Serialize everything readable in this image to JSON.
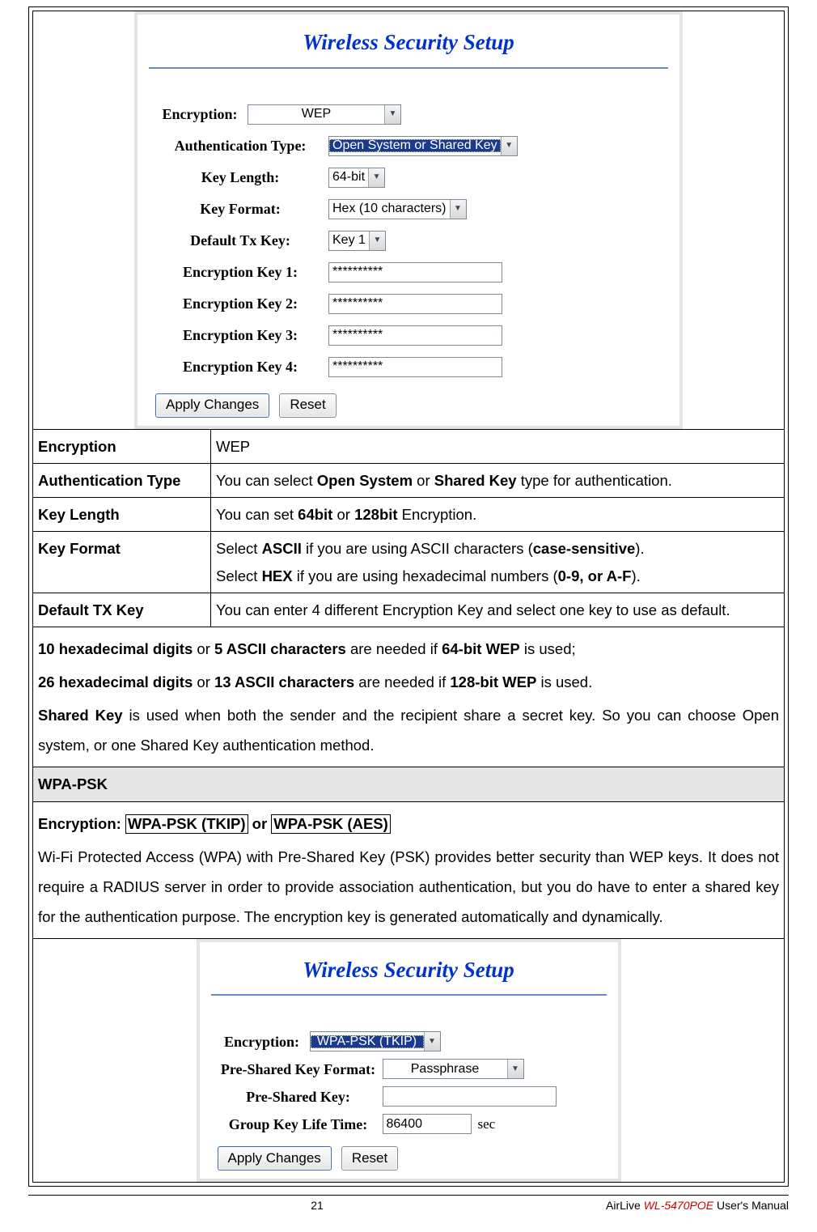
{
  "screenshot1": {
    "title": "Wireless Security Setup",
    "encryption_label": "Encryption:",
    "encryption_value": "WEP",
    "auth_label": "Authentication Type:",
    "auth_value": "Open System or Shared Key",
    "keylen_label": "Key Length:",
    "keylen_value": "64-bit",
    "keyfmt_label": "Key Format:",
    "keyfmt_value": "Hex (10 characters)",
    "deftx_label": "Default Tx Key:",
    "deftx_value": "Key 1",
    "ek1_label": "Encryption Key 1:",
    "ek1_value": "**********",
    "ek2_label": "Encryption Key 2:",
    "ek2_value": "**********",
    "ek3_label": "Encryption Key 3:",
    "ek3_value": "**********",
    "ek4_label": "Encryption Key 4:",
    "ek4_value": "**********",
    "apply": "Apply Changes",
    "reset": "Reset"
  },
  "table": {
    "r1_h": "Encryption",
    "r1_v": "WEP",
    "r2_h": "Authentication Type",
    "r2_v1": "You can select ",
    "r2_b1": "Open System",
    "r2_v2": " or ",
    "r2_b2": "Shared Key",
    "r2_v3": " type for authentication.",
    "r3_h": "Key Length",
    "r3_v1": "You can set ",
    "r3_b1": "64bit",
    "r3_v2": " or ",
    "r3_b2": "128bit",
    "r3_v3": " Encryption.",
    "r4_h": "Key Format",
    "r4_v1": "Select ",
    "r4_b1": "ASCII",
    "r4_v2": " if you are using ASCII characters (",
    "r4_b2": "case-sensitive",
    "r4_v3": ").",
    "r4_v4": "Select ",
    "r4_b3": "HEX",
    "r4_v5": " if you are using hexadecimal numbers (",
    "r4_b4": "0-9, or A-F",
    "r4_v6": ").",
    "r5_h": "Default TX Key",
    "r5_v": "You can enter 4 different Encryption Key and select one key to use as default.",
    "note1_b1": "10 hexadecimal digits",
    "note1_t1": " or ",
    "note1_b2": "5 ASCII characters",
    "note1_t2": " are needed if ",
    "note1_b3": "64-bit WEP",
    "note1_t3": " is used;",
    "note2_b1": "26 hexadecimal digits",
    "note2_t1": " or ",
    "note2_b2": "13 ASCII characters",
    "note2_t2": " are needed if ",
    "note2_b3": "128-bit WEP",
    "note2_t3": " is used.",
    "note3_b1": "Shared Key",
    "note3_t1": " is used when both the sender and the recipient share a secret key. So you can choose Open system, or one Shared Key authentication method.",
    "wpapsk_hdr": "WPA-PSK",
    "wpa_enc_label": "Encryption: ",
    "wpa_box1": "WPA-PSK (TKIP)",
    "wpa_or": " or ",
    "wpa_box2": "WPA-PSK (AES)",
    "wpa_desc": "Wi-Fi Protected Access (WPA) with Pre-Shared Key (PSK) provides better security than WEP keys. It does not require a RADIUS server in order to provide association authentication, but you do have to enter a shared key for the authentication purpose. The encryption key is generated automatically and dynamically."
  },
  "screenshot2": {
    "title": "Wireless Security Setup",
    "encryption_label": "Encryption:",
    "encryption_value": "WPA-PSK (TKIP)",
    "pskfmt_label": "Pre-Shared Key Format:",
    "pskfmt_value": "Passphrase",
    "psk_label": "Pre-Shared Key:",
    "psk_value": "",
    "gklt_label": "Group Key Life Time:",
    "gklt_value": "86400",
    "sec": "sec",
    "apply": "Apply Changes",
    "reset": "Reset"
  },
  "footer": {
    "page": "21",
    "manual_pre": "AirLive ",
    "manual_mid": "WL-5470POE",
    "manual_post": " User's Manual"
  }
}
